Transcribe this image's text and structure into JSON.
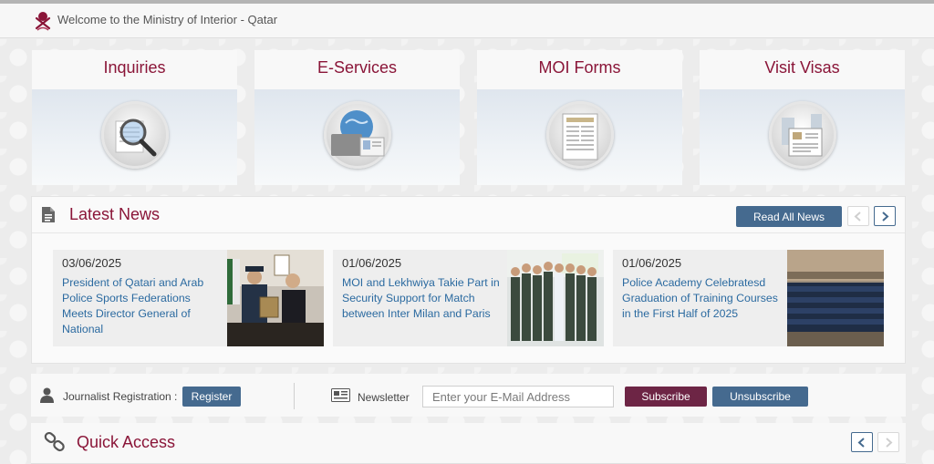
{
  "header": {
    "welcome": "Welcome to the Ministry of Interior - Qatar"
  },
  "tiles": [
    {
      "label": "Inquiries"
    },
    {
      "label": "E-Services"
    },
    {
      "label": "MOI Forms"
    },
    {
      "label": "Visit Visas"
    }
  ],
  "news": {
    "title": "Latest News",
    "read_all_label": "Read All News",
    "items": [
      {
        "date": "03/06/2025",
        "headline": "President of Qatari and Arab Police Sports Federations Meets Director General of National"
      },
      {
        "date": "01/06/2025",
        "headline": "MOI and Lekhwiya Takie Part in Security Support for Match between Inter Milan and Paris"
      },
      {
        "date": "01/06/2025",
        "headline": "Police Academy Celebratesd Graduation of Training Courses in the First Half of 2025"
      }
    ]
  },
  "journalist": {
    "label": "Journalist Registration :",
    "register_label": "Register"
  },
  "newsletter": {
    "label": "Newsletter",
    "placeholder": "Enter your E-Mail Address",
    "subscribe_label": "Subscribe",
    "unsubscribe_label": "Unsubscribe"
  },
  "quick_access": {
    "title": "Quick Access"
  },
  "colors": {
    "maroon": "#8a1538",
    "blue": "#456a8f",
    "subscribe": "#6d2545",
    "link": "#2b6aa0"
  }
}
